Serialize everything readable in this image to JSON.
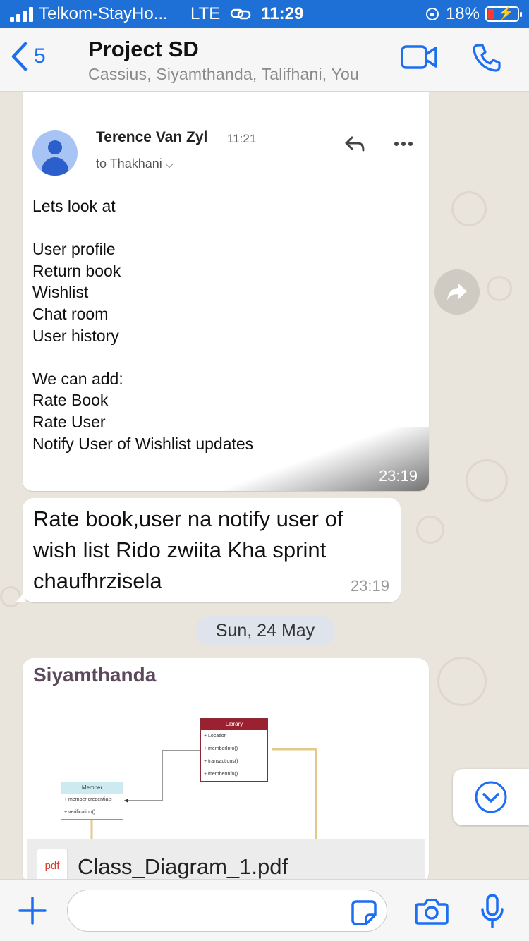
{
  "status_bar": {
    "carrier": "Telkom-StayHo...",
    "network": "LTE",
    "time": "11:29",
    "battery": "18%"
  },
  "header": {
    "back_count": "5",
    "title": "Project SD",
    "subtitle": "Cassius, Siyamthanda, Talifhani, You"
  },
  "messages": {
    "email_image": {
      "sender": "Terence Van Zyl",
      "sent_time": "11:21",
      "recipient": "to Thakhani",
      "body": "Lets look at\n\nUser profile\nReturn book\nWishlist\nChat room\nUser history\n\nWe can add:\nRate Book\nRate User\nNotify User of Wishlist updates",
      "time": "23:19"
    },
    "text": {
      "body": "Rate book,user na notify user of wish list Rido zwiita Kha sprint chaufhrzisela",
      "time": "23:19"
    },
    "date_divider": "Sun, 24 May",
    "pdf": {
      "author": "Siyamthanda",
      "badge": "pdf",
      "file_name": "Class_Diagram_1.pdf",
      "diagram": {
        "library_title": "Library",
        "library_rows": [
          "+ Location",
          "+ memberInfo()",
          "+ transactions()",
          "+ memberInfo()"
        ],
        "member_title": "Member",
        "member_rows": [
          "+ member credentials",
          "+ verification()"
        ]
      }
    }
  },
  "input": {
    "placeholder": ""
  },
  "colors": {
    "status_bar": "#1e6fd6",
    "accent": "#1d6ff2",
    "wallpaper": "#e9e4dc"
  }
}
